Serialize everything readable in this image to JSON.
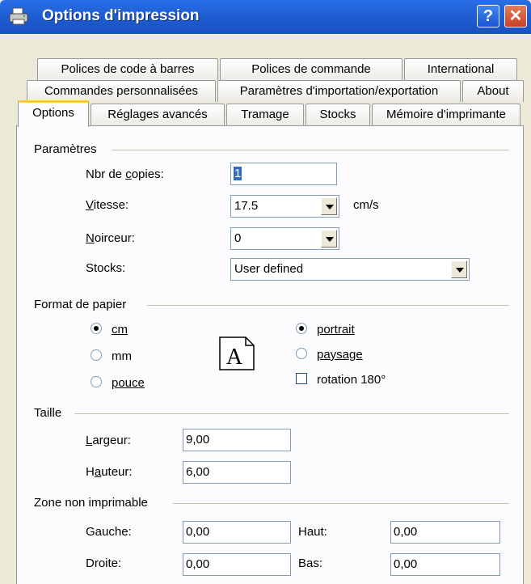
{
  "window": {
    "title": "Options d'impression",
    "help_label": "?",
    "close_label": "✕"
  },
  "tabs": {
    "row1": [
      "Polices de code à barres",
      "Polices de commande",
      "International"
    ],
    "row2": [
      "Commandes personnalisées",
      "Paramètres d'importation/exportation",
      "About"
    ],
    "row3": [
      "Options",
      "Réglages avancés",
      "Tramage",
      "Stocks",
      "Mémoire d'imprimante"
    ],
    "active": "Options"
  },
  "parametres": {
    "title": "Paramètres",
    "copies_label": "Nbr de copies:",
    "copies_value": "1",
    "vitesse_label": "Vitesse:",
    "vitesse_value": "17.5",
    "vitesse_unit": "cm/s",
    "noirceur_label": "Noirceur:",
    "noirceur_value": "0",
    "stocks_label": "Stocks:",
    "stocks_value": "User defined"
  },
  "format": {
    "title": "Format de papier",
    "units": [
      {
        "label": "cm",
        "selected": true
      },
      {
        "label": "mm",
        "selected": false
      },
      {
        "label": "pouce",
        "selected": false
      }
    ],
    "orientations": [
      {
        "label": "portrait",
        "selected": true
      },
      {
        "label": "paysage",
        "selected": false
      }
    ],
    "rotation_label": "rotation 180°",
    "rotation_checked": false,
    "orientation_icon_letter": "A"
  },
  "taille": {
    "title": "Taille",
    "largeur_label": "Largeur:",
    "largeur_value": "9,00",
    "hauteur_label": "Hauteur:",
    "hauteur_value": "6,00"
  },
  "zone": {
    "title": "Zone non imprimable",
    "gauche_label": "Gauche:",
    "gauche_value": "0,00",
    "droite_label": "Droite:",
    "droite_value": "0,00",
    "haut_label": "Haut:",
    "haut_value": "0,00",
    "bas_label": "Bas:",
    "bas_value": "0,00"
  },
  "colors": {
    "titlebar": "#1E5ED3",
    "dialog_bg": "#ECE9D8",
    "panel_bg": "#FCFCFE",
    "active_tab_accent": "#FFC83C"
  }
}
